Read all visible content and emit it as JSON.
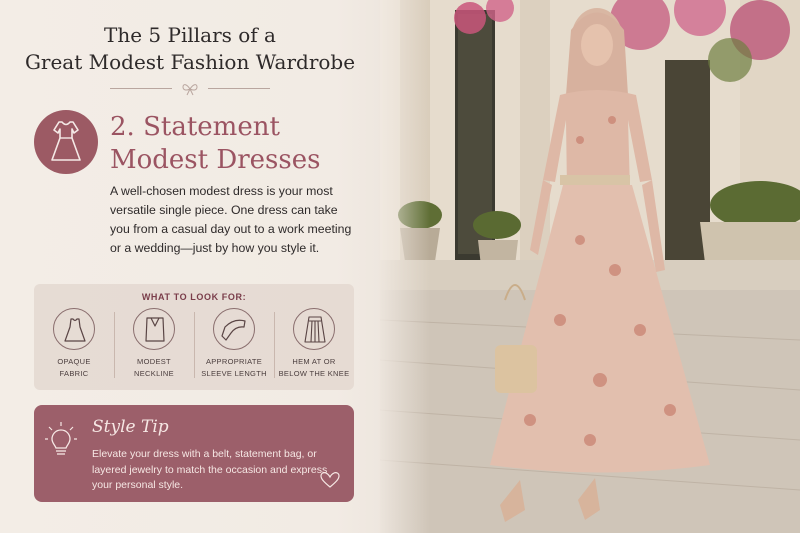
{
  "header": {
    "title_line1": "The 5 Pillars of a",
    "title_line2": "Great Modest Fashion Wardrobe"
  },
  "section": {
    "title_line1": "2. Statement",
    "title_line2": "Modest Dresses",
    "icon": "dress-icon",
    "description": "A well-chosen modest dress is your most versatile single piece. One dress can take you from a casual day out to a work meeting or a wedding—just by how you style it."
  },
  "look_for": {
    "heading": "WHAT TO LOOK FOR:",
    "items": [
      {
        "line1": "OPAQUE",
        "line2": "FABRIC",
        "icon": "dress-outline-icon"
      },
      {
        "line1": "MODEST",
        "line2": "NECKLINE",
        "icon": "neckline-icon"
      },
      {
        "line1": "APPROPRIATE",
        "line2": "SLEEVE LENGTH",
        "icon": "sleeve-icon"
      },
      {
        "line1": "HEM AT OR",
        "line2": "BELOW THE KNEE",
        "icon": "skirt-icon"
      }
    ]
  },
  "tip": {
    "title": "Style Tip",
    "text": "Elevate your dress with a belt, statement bag, or layered jewelry to match the occasion and express your personal style.",
    "icon": "lightbulb-icon",
    "heart_icon": "heart-icon"
  },
  "colors": {
    "accent": "#9c5462",
    "tip_background": "#9c5f6a",
    "panel_background": "#f2ebe4"
  }
}
